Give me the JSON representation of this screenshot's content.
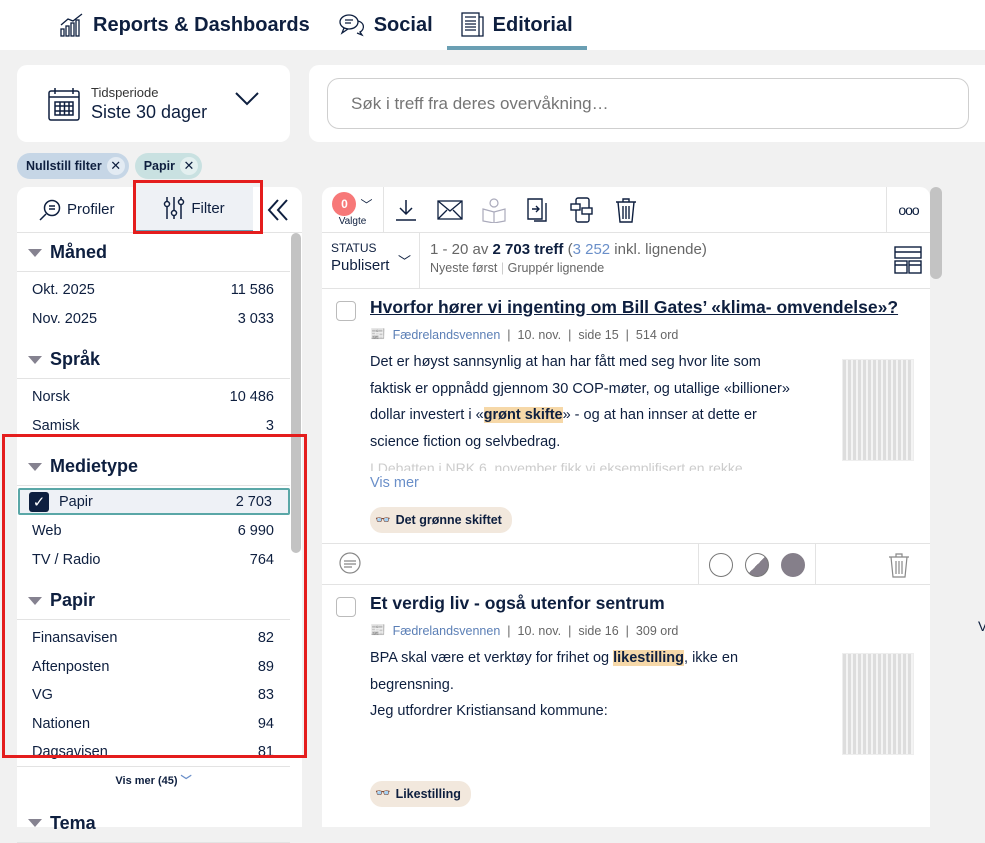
{
  "nav": {
    "tabs": [
      {
        "label": "Reports & Dashboards",
        "icon": "chart-icon"
      },
      {
        "label": "Social",
        "icon": "chat-bubbles-icon"
      },
      {
        "label": "Editorial",
        "icon": "newspaper-icon",
        "active": true
      }
    ]
  },
  "period": {
    "label": "Tidsperiode",
    "value": "Siste 30 dager"
  },
  "search": {
    "placeholder": "Søk i treff fra deres overvåkning…"
  },
  "chips": [
    {
      "label": "Nullstill filter",
      "color": "#c6d6e6"
    },
    {
      "label": "Papir",
      "color": "#c9e1e1"
    }
  ],
  "sidebar": {
    "tabs": [
      {
        "label": "Profiler"
      },
      {
        "label": "Filter",
        "active": true
      }
    ],
    "sections": [
      {
        "title": "Måned",
        "items": [
          {
            "label": "Okt. 2025",
            "count": "11 586"
          },
          {
            "label": "Nov. 2025",
            "count": "3 033"
          }
        ]
      },
      {
        "title": "Språk",
        "items": [
          {
            "label": "Norsk",
            "count": "10 486"
          },
          {
            "label": "Samisk",
            "count": "3"
          }
        ]
      },
      {
        "title": "Medietype",
        "items": [
          {
            "label": "Papir",
            "count": "2 703",
            "checked": true
          },
          {
            "label": "Web",
            "count": "6 990"
          },
          {
            "label": "TV / Radio",
            "count": "764"
          }
        ]
      },
      {
        "title": "Papir",
        "items": [
          {
            "label": "Finansavisen",
            "count": "82"
          },
          {
            "label": "Aftenposten",
            "count": "89"
          },
          {
            "label": "VG",
            "count": "83"
          },
          {
            "label": "Nationen",
            "count": "94"
          },
          {
            "label": "Dagsavisen",
            "count": "81"
          }
        ],
        "more": "Vis mer (45)"
      },
      {
        "title": "Tema",
        "items": []
      }
    ]
  },
  "toolbar": {
    "selected_count": "0",
    "selected_label": "Valgte",
    "more": "ooo"
  },
  "status": {
    "label": "STATUS",
    "value": "Publisert",
    "range": "1 - 20 av",
    "total": "2 703 treff",
    "similar_open": "(",
    "similar_count": "3 252",
    "similar_rest": " inkl. lignende)",
    "sort": "Nyeste først",
    "group": "Gruppér lignende"
  },
  "articles": [
    {
      "title": "Hvorfor hører vi ingenting om Bill Gates’ «klima- omvendelse»?",
      "source": "Fædrelandsvennen",
      "date": "10. nov.",
      "page": "side 15",
      "words": "514 ord",
      "text_before": "Det er høyst sannsynlig at han har fått med seg hvor lite som faktisk er oppnådd gjennom 30 COP-møter, og utallige «billioner» dollar investert i «",
      "highlight": "grønt skifte",
      "text_after": "» - og at han innser at dette er science fiction og selvbedrag.",
      "faded": "I Debatten i NRK 6. november fikk vi eksemplifisert en rekke",
      "more": "Vis mer",
      "tag": "Det grønne skiftet"
    },
    {
      "title": "Et verdig liv - også utenfor sentrum",
      "source": "Fædrelandsvennen",
      "date": "10. nov.",
      "page": "side 16",
      "words": "309 ord",
      "text_before": "BPA skal være et verktøy for frihet og ",
      "highlight": "likestilling",
      "text_after": ", ikke en begrensning.",
      "line2": "Jeg utfordrer Kristiansand kommune:",
      "tag": "Likestilling"
    }
  ],
  "edge_text": "V"
}
